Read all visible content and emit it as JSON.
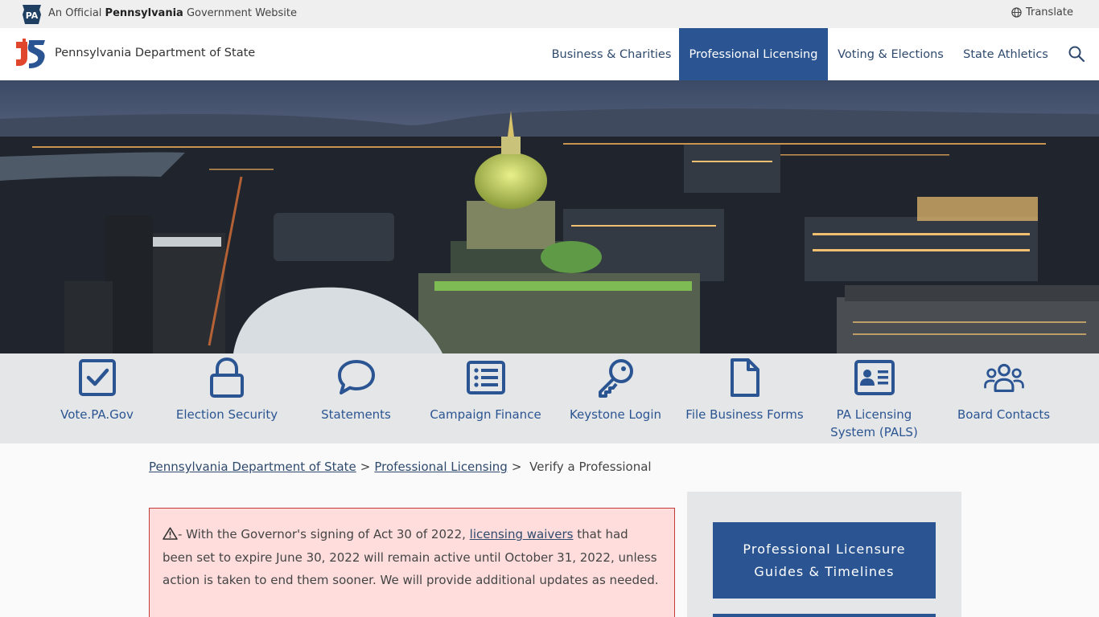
{
  "official_bar": {
    "prefix": "An Official ",
    "state": "Pennsylvania",
    "suffix": " Government Website",
    "keystone_label": "PA",
    "translate": "Translate"
  },
  "header": {
    "site_title": "Pennsylvania Department of State",
    "nav": [
      {
        "label": "Business & Charities",
        "active": false
      },
      {
        "label": "Professional Licensing",
        "active": true
      },
      {
        "label": "Voting & Elections",
        "active": false
      },
      {
        "label": "State Athletics",
        "active": false
      }
    ]
  },
  "quick_links": [
    {
      "label": "Vote.PA.Gov",
      "icon": "checkbox-icon"
    },
    {
      "label": "Election Security",
      "icon": "lock-icon"
    },
    {
      "label": "Statements",
      "icon": "speech-bubble-icon"
    },
    {
      "label": "Campaign Finance",
      "icon": "list-icon"
    },
    {
      "label": "Keystone Login",
      "icon": "key-icon"
    },
    {
      "label": "File Business Forms",
      "icon": "file-icon"
    },
    {
      "label": "PA Licensing\nSystem (PALS)",
      "icon": "id-card-icon"
    },
    {
      "label": "Board Contacts",
      "icon": "users-icon"
    }
  ],
  "breadcrumb": {
    "items": [
      "Pennsylvania Department of State",
      "Professional Licensing"
    ],
    "current": "Verify a Professional",
    "separator": ">"
  },
  "alert": {
    "before_link": "- With the Governor's signing of Act 30 of 2022, ",
    "link": "licensing waivers",
    "after_link": " that had been set to expire June 30, 2022 will remain active until October 31, 2022, unless action is taken to end them sooner. We will provide additional updates as needed."
  },
  "sidebar": {
    "button_label": "Professional Licensure\nGuides & Timelines"
  },
  "colors": {
    "primary": "#2b5592",
    "alert_bg": "#ffdddd",
    "alert_border": "#c43a3a",
    "quick_bar": "#e4e6e8"
  }
}
